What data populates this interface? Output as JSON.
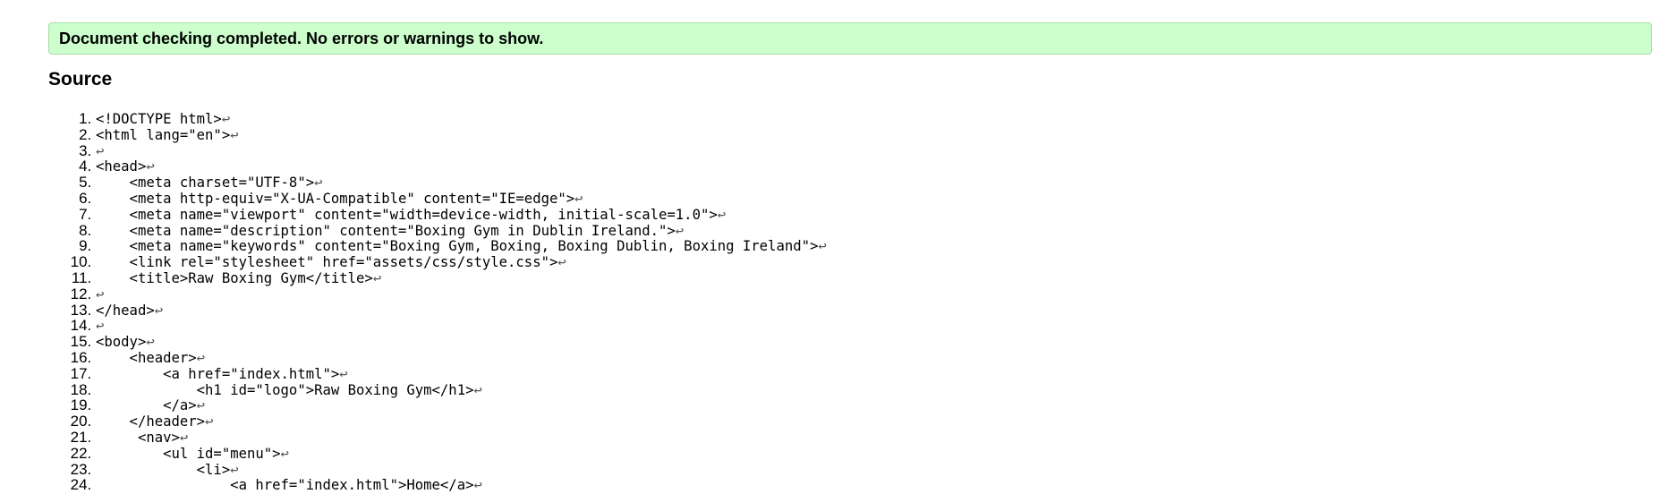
{
  "banner": {
    "message": "Document checking completed. No errors or warnings to show."
  },
  "source": {
    "heading": "Source",
    "return_glyph": "↩",
    "lines": [
      "<!DOCTYPE html>",
      "<html lang=\"en\">",
      "",
      "<head>",
      "    <meta charset=\"UTF-8\">",
      "    <meta http-equiv=\"X-UA-Compatible\" content=\"IE=edge\">",
      "    <meta name=\"viewport\" content=\"width=device-width, initial-scale=1.0\">",
      "    <meta name=\"description\" content=\"Boxing Gym in Dublin Ireland.\">",
      "    <meta name=\"keywords\" content=\"Boxing Gym, Boxing, Boxing Dublin, Boxing Ireland\">",
      "    <link rel=\"stylesheet\" href=\"assets/css/style.css\">",
      "    <title>Raw Boxing Gym</title>",
      "",
      "</head>",
      "",
      "<body>",
      "    <header>",
      "        <a href=\"index.html\">",
      "            <h1 id=\"logo\">Raw Boxing Gym</h1>",
      "        </a>",
      "    </header>",
      "     <nav>",
      "        <ul id=\"menu\">",
      "            <li>",
      "                <a href=\"index.html\">Home</a>"
    ]
  }
}
